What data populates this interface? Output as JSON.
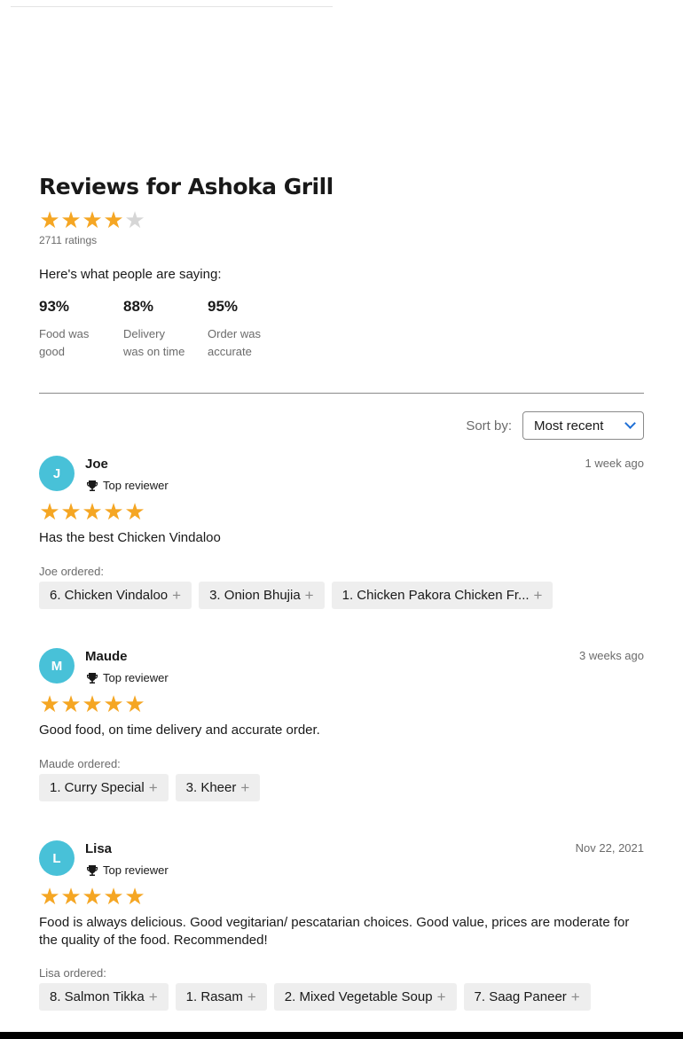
{
  "header": {
    "title": "Reviews for Ashoka Grill",
    "rating_stars": 4,
    "ratings_count": "2711 ratings",
    "saying": "Here's what people are saying:",
    "stats": [
      {
        "value": "93%",
        "label_line1": "Food was",
        "label_line2": "good"
      },
      {
        "value": "88%",
        "label_line1": "Delivery",
        "label_line2": "was on time"
      },
      {
        "value": "95%",
        "label_line1": "Order was",
        "label_line2": "accurate"
      }
    ]
  },
  "sort": {
    "label": "Sort by:",
    "selected": "Most recent"
  },
  "colors": {
    "star": "#f5a623",
    "avatar": "#48c1d8",
    "accent": "#1f6fd6"
  },
  "reviews": [
    {
      "initial": "J",
      "name": "Joe",
      "badge": "Top reviewer",
      "date": "1 week ago",
      "stars": 5,
      "text": "Has the best Chicken Vindaloo",
      "ordered_label": "Joe ordered:",
      "items": [
        "6. Chicken Vindaloo",
        "3. Onion Bhujia",
        "1. Chicken Pakora Chicken Fr..."
      ]
    },
    {
      "initial": "M",
      "name": "Maude",
      "badge": "Top reviewer",
      "date": "3 weeks ago",
      "stars": 5,
      "text": "Good food, on time delivery and accurate order.",
      "ordered_label": "Maude ordered:",
      "items": [
        "1. Curry Special",
        "3. Kheer"
      ]
    },
    {
      "initial": "L",
      "name": "Lisa",
      "badge": "Top reviewer",
      "date": "Nov 22, 2021",
      "stars": 5,
      "text": "Food is always delicious. Good vegitarian/ pescatarian choices. Good value, prices are moderate for the quality of the food. Recommended!",
      "ordered_label": "Lisa ordered:",
      "items": [
        "8. Salmon Tikka",
        "1. Rasam",
        "2. Mixed Vegetable Soup",
        "7. Saag Paneer"
      ]
    }
  ]
}
